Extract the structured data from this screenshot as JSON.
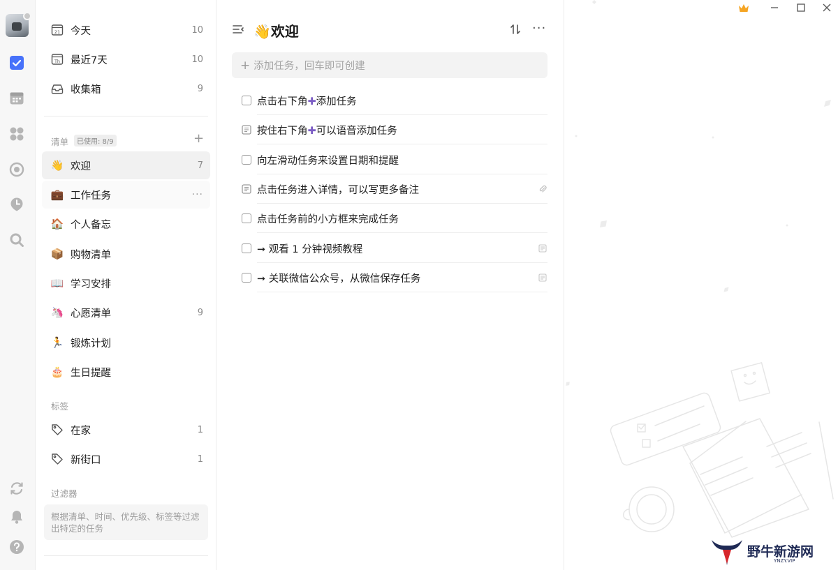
{
  "colors": {
    "accent_blue": "#4772fa",
    "purple_plus": "#7b5cc4",
    "crown": "#f5a524"
  },
  "rail": {
    "icons": [
      "task-check-icon",
      "calendar-icon",
      "grid-apps-icon",
      "focus-icon",
      "pomodoro-icon",
      "search-icon",
      "sync-icon",
      "bell-icon",
      "help-icon"
    ]
  },
  "sidebar": {
    "smart_lists": [
      {
        "label": "今天",
        "count": "10",
        "icon": "calendar-day-icon",
        "icon_text": "21"
      },
      {
        "label": "最近7天",
        "count": "10",
        "icon": "calendar-week-icon",
        "icon_text": "Th"
      },
      {
        "label": "收集箱",
        "count": "9",
        "icon": "inbox-icon"
      }
    ],
    "lists_section": {
      "title": "清单",
      "usage": "已使用: 8/9"
    },
    "lists": [
      {
        "label": "欢迎",
        "count": "7",
        "emoji": "👋"
      },
      {
        "label": "工作任务",
        "count": "",
        "emoji": "💼"
      },
      {
        "label": "个人备忘",
        "count": "",
        "emoji": "🏠"
      },
      {
        "label": "购物清单",
        "count": "",
        "emoji": "📦"
      },
      {
        "label": "学习安排",
        "count": "",
        "emoji": "📖"
      },
      {
        "label": "心愿清单",
        "count": "9",
        "emoji": "🦄"
      },
      {
        "label": "锻炼计划",
        "count": "",
        "emoji": "🏃"
      },
      {
        "label": "生日提醒",
        "count": "",
        "emoji": "🎂"
      }
    ],
    "tags_section": {
      "title": "标签"
    },
    "tags": [
      {
        "label": "在家",
        "count": "1"
      },
      {
        "label": "新街口",
        "count": "1"
      }
    ],
    "filters_section": {
      "title": "过滤器",
      "hint": "根据清单、时间、优先级、标签等过滤出特定的任务"
    }
  },
  "main": {
    "title_emoji": "👋",
    "title": "欢迎",
    "add_placeholder": "添加任务，回车即可创建",
    "tasks": [
      {
        "pre": "点击右下角",
        "plus": "✚",
        "post": "添加任务",
        "kind": "checkbox",
        "attachment": false,
        "note": false
      },
      {
        "pre": "按住右下角",
        "plus": "✚",
        "post": "可以语音添加任务",
        "kind": "note",
        "attachment": false,
        "note": false
      },
      {
        "pre": "向左滑动任务来设置日期和提醒",
        "plus": "",
        "post": "",
        "kind": "checkbox",
        "attachment": false,
        "note": false
      },
      {
        "pre": "点击任务进入详情，可以写更多备注",
        "plus": "",
        "post": "",
        "kind": "note",
        "attachment": true,
        "note": false
      },
      {
        "pre": "点击任务前的小方框来完成任务",
        "plus": "",
        "post": "",
        "kind": "checkbox",
        "attachment": false,
        "note": false
      },
      {
        "pre": "➞ 观看 1 分钟视频教程",
        "plus": "",
        "post": "",
        "kind": "checkbox",
        "attachment": false,
        "note": true
      },
      {
        "pre": "➞ 关联微信公众号，从微信保存任务",
        "plus": "",
        "post": "",
        "kind": "checkbox",
        "attachment": false,
        "note": true
      }
    ]
  },
  "watermark": {
    "main": "野牛新游网",
    "sub": "YNZY.VIP"
  }
}
